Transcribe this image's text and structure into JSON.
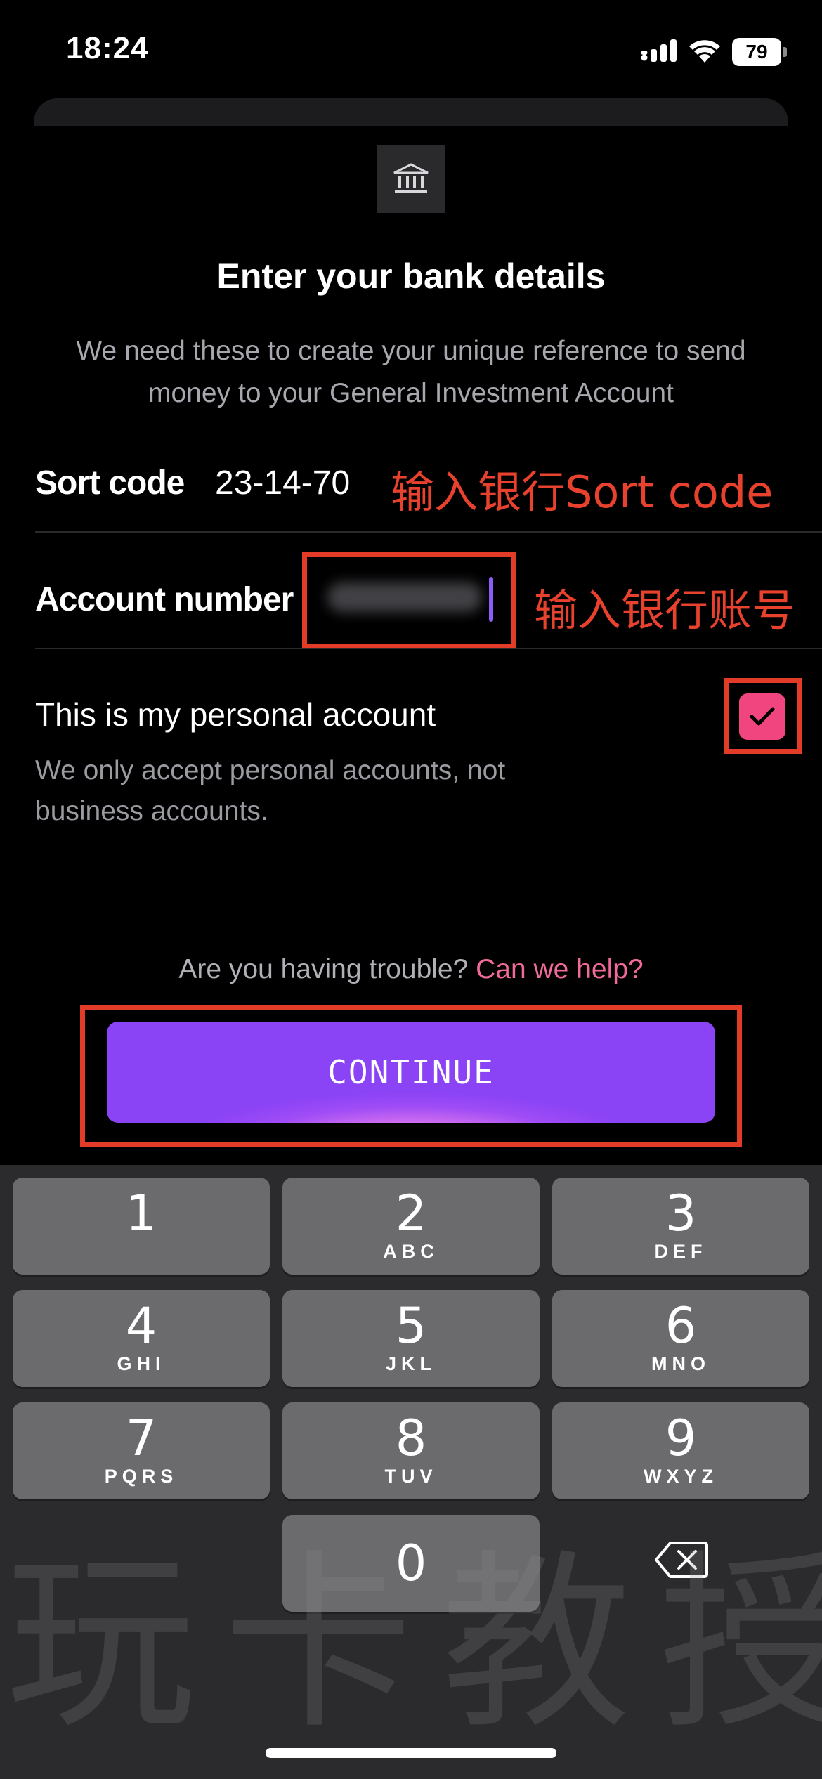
{
  "status_bar": {
    "time": "18:24",
    "battery": "79"
  },
  "header": {
    "title": "Enter your bank details",
    "subtitle": "We need these to create your unique reference to send money to your General Investment Account"
  },
  "form": {
    "sort_code_label": "Sort code",
    "sort_code_value": "23-14-70",
    "account_number_label": "Account number",
    "personal_title": "This is my personal account",
    "personal_subtitle": "We only accept personal accounts, not business accounts.",
    "personal_checked": true
  },
  "annotations": {
    "sort_code_note": "输入银行Sort code",
    "account_note": "输入银行账号",
    "color": "#e23b27"
  },
  "help": {
    "question": "Are you having trouble?",
    "link": "Can we help?"
  },
  "continue_label": "CONTINUE",
  "keypad": [
    {
      "digit": "1",
      "letters": ""
    },
    {
      "digit": "2",
      "letters": "ABC"
    },
    {
      "digit": "3",
      "letters": "DEF"
    },
    {
      "digit": "4",
      "letters": "GHI"
    },
    {
      "digit": "5",
      "letters": "JKL"
    },
    {
      "digit": "6",
      "letters": "MNO"
    },
    {
      "digit": "7",
      "letters": "PQRS"
    },
    {
      "digit": "8",
      "letters": "TUV"
    },
    {
      "digit": "9",
      "letters": "WXYZ"
    },
    {
      "digit": "0",
      "letters": ""
    }
  ],
  "watermark": "玩卡教授",
  "colors": {
    "accent": "#9f4cf6",
    "checkbox": "#f0457f",
    "link": "#f06a9a",
    "background": "#000000"
  },
  "icons": [
    "signal-icon",
    "wifi-icon",
    "battery-icon",
    "bank-icon",
    "checkmark-icon",
    "backspace-icon"
  ]
}
